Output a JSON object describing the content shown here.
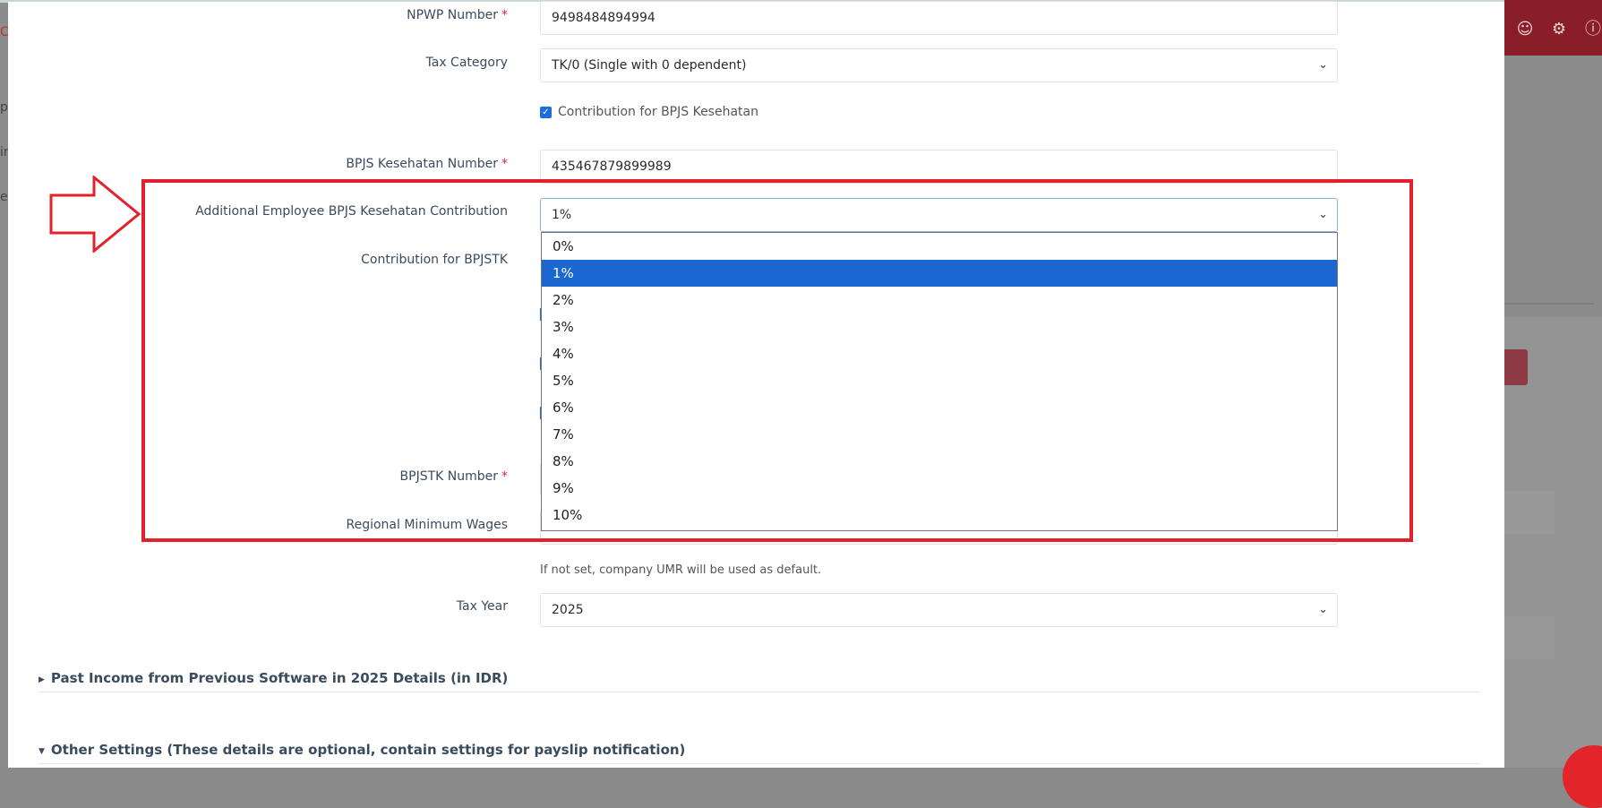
{
  "background": {
    "left_letters": [
      "C",
      "pa",
      "in",
      "e"
    ],
    "topbar_icons": [
      "user-icon",
      "gear-icon",
      "help-icon"
    ]
  },
  "form": {
    "npwp": {
      "label": "NPWP Number",
      "required": "*",
      "value": "9498484894994"
    },
    "tax_category": {
      "label": "Tax Category",
      "value": "TK/0 (Single with 0 dependent)"
    },
    "bpjs_kes_checkbox": {
      "label": "Contribution for BPJS Kesehatan",
      "checked": true
    },
    "bpjs_kes_number": {
      "label": "BPJS Kesehatan Number",
      "required": "*",
      "value": "435467879899989"
    },
    "additional_contribution": {
      "label": "Additional Employee BPJS Kesehatan Contribution",
      "value": "1%",
      "options": [
        "0%",
        "1%",
        "2%",
        "3%",
        "4%",
        "5%",
        "6%",
        "7%",
        "8%",
        "9%",
        "10%"
      ],
      "selected_index": 1
    },
    "bpjstk_contribution": {
      "label": "Contribution for BPJSTK"
    },
    "bpjstk_number": {
      "label": "BPJSTK Number",
      "required": "*"
    },
    "regional_min_wages": {
      "label": "Regional Minimum Wages",
      "hint": "If not set, company UMR will be used as default."
    },
    "tax_year": {
      "label": "Tax Year",
      "value": "2025"
    }
  },
  "sections": {
    "past_income": "Past Income from Previous Software in 2025 Details (in IDR)",
    "other_settings": "Other Settings (These details are optional, contain settings for payslip notification)"
  },
  "annotation": {
    "color": "#e3212b"
  }
}
